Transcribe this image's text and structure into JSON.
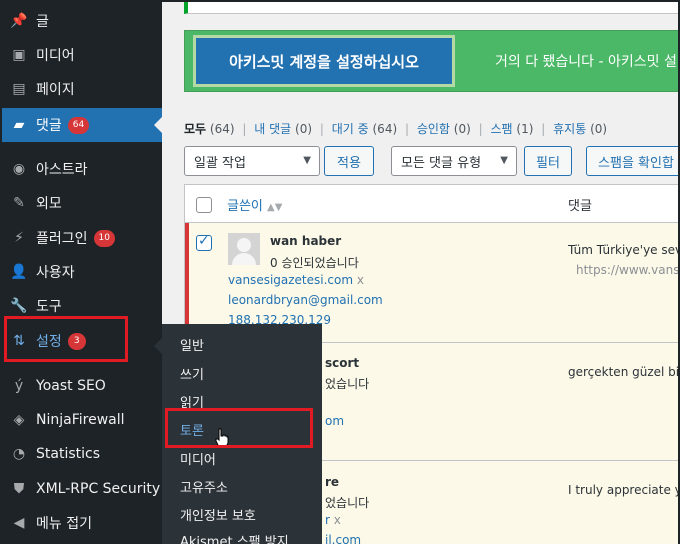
{
  "sidebar": {
    "items": [
      {
        "label": "글",
        "icon": "pin-icon"
      },
      {
        "label": "미디어",
        "icon": "media-icon"
      },
      {
        "label": "페이지",
        "icon": "page-icon"
      },
      {
        "label": "댓글",
        "icon": "comment-icon",
        "badge": "64"
      },
      {
        "label": "아스트라",
        "icon": "astra-icon"
      },
      {
        "label": "외모",
        "icon": "brush-icon"
      },
      {
        "label": "플러그인",
        "icon": "plugin-icon",
        "badge": "10"
      },
      {
        "label": "사용자",
        "icon": "user-icon"
      },
      {
        "label": "도구",
        "icon": "wrench-icon"
      },
      {
        "label": "설정",
        "icon": "settings-icon",
        "badge": "3"
      },
      {
        "label": "Yoast SEO",
        "icon": "yoast-icon"
      },
      {
        "label": "NinjaFirewall",
        "icon": "ninja-icon"
      },
      {
        "label": "Statistics",
        "icon": "pie-chart-icon"
      },
      {
        "label": "XML-RPC Security",
        "icon": "shield-icon"
      },
      {
        "label": "메뉴 접기",
        "icon": "collapse-icon"
      }
    ]
  },
  "submenu": {
    "items": [
      "일반",
      "쓰기",
      "읽기",
      "토론",
      "미디어",
      "고유주소",
      "개인정보 보호",
      "Akismet 스팸 방지"
    ]
  },
  "banner": {
    "button_label": "아키스밋 계정을 설정하십시오",
    "text": "거의 다 됐습니다 - 아키스밋 설"
  },
  "filters": {
    "all": "모두",
    "all_count": "(64)",
    "mine": "내 댓글",
    "mine_count": "(0)",
    "pending": "대기 중",
    "pending_count": "(64)",
    "approved": "승인함",
    "approved_count": "(0)",
    "spam": "스팸",
    "spam_count": "(1)",
    "trash": "휴지통",
    "trash_count": "(0)"
  },
  "toolbar": {
    "bulk_action": "일괄 작업",
    "apply": "적용",
    "comment_type": "모든 댓글 유형",
    "filter": "필터",
    "check_spam": "스팸을 확인합"
  },
  "table": {
    "col_author": "글쓴이",
    "col_comment": "댓글",
    "rows": [
      {
        "author": "wan haber",
        "status": "0 승인되었습니다",
        "site": "vansesigazetesi.com",
        "remove": "x",
        "email": "leonardbryan@gmail.com",
        "ip": "188.132.230.129",
        "comment": "Tüm Türkiye'ye sevk",
        "comment_url": "https://www.vanse"
      },
      {
        "author": "scort",
        "status": "었습니다",
        "site": "om",
        "comment": "gerçekten güzel bir"
      },
      {
        "author": "re",
        "status": "었습니다",
        "site": "r",
        "remove": "x",
        "email": "il.com",
        "comment": "I truly appreciate yo"
      }
    ]
  }
}
